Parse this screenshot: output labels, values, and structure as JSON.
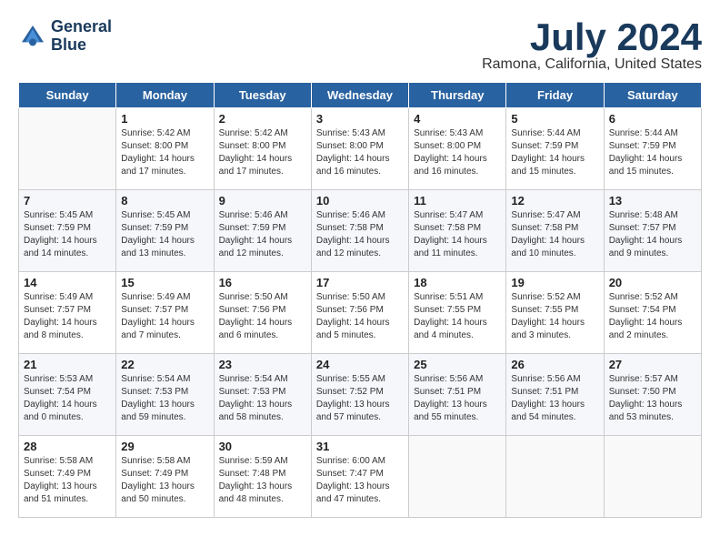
{
  "header": {
    "logo_line1": "General",
    "logo_line2": "Blue",
    "month": "July 2024",
    "location": "Ramona, California, United States"
  },
  "days_of_week": [
    "Sunday",
    "Monday",
    "Tuesday",
    "Wednesday",
    "Thursday",
    "Friday",
    "Saturday"
  ],
  "weeks": [
    [
      {
        "day": "",
        "empty": true
      },
      {
        "day": "1",
        "sunrise": "Sunrise: 5:42 AM",
        "sunset": "Sunset: 8:00 PM",
        "daylight": "Daylight: 14 hours and 17 minutes."
      },
      {
        "day": "2",
        "sunrise": "Sunrise: 5:42 AM",
        "sunset": "Sunset: 8:00 PM",
        "daylight": "Daylight: 14 hours and 17 minutes."
      },
      {
        "day": "3",
        "sunrise": "Sunrise: 5:43 AM",
        "sunset": "Sunset: 8:00 PM",
        "daylight": "Daylight: 14 hours and 16 minutes."
      },
      {
        "day": "4",
        "sunrise": "Sunrise: 5:43 AM",
        "sunset": "Sunset: 8:00 PM",
        "daylight": "Daylight: 14 hours and 16 minutes."
      },
      {
        "day": "5",
        "sunrise": "Sunrise: 5:44 AM",
        "sunset": "Sunset: 7:59 PM",
        "daylight": "Daylight: 14 hours and 15 minutes."
      },
      {
        "day": "6",
        "sunrise": "Sunrise: 5:44 AM",
        "sunset": "Sunset: 7:59 PM",
        "daylight": "Daylight: 14 hours and 15 minutes."
      }
    ],
    [
      {
        "day": "7",
        "sunrise": "Sunrise: 5:45 AM",
        "sunset": "Sunset: 7:59 PM",
        "daylight": "Daylight: 14 hours and 14 minutes."
      },
      {
        "day": "8",
        "sunrise": "Sunrise: 5:45 AM",
        "sunset": "Sunset: 7:59 PM",
        "daylight": "Daylight: 14 hours and 13 minutes."
      },
      {
        "day": "9",
        "sunrise": "Sunrise: 5:46 AM",
        "sunset": "Sunset: 7:59 PM",
        "daylight": "Daylight: 14 hours and 12 minutes."
      },
      {
        "day": "10",
        "sunrise": "Sunrise: 5:46 AM",
        "sunset": "Sunset: 7:58 PM",
        "daylight": "Daylight: 14 hours and 12 minutes."
      },
      {
        "day": "11",
        "sunrise": "Sunrise: 5:47 AM",
        "sunset": "Sunset: 7:58 PM",
        "daylight": "Daylight: 14 hours and 11 minutes."
      },
      {
        "day": "12",
        "sunrise": "Sunrise: 5:47 AM",
        "sunset": "Sunset: 7:58 PM",
        "daylight": "Daylight: 14 hours and 10 minutes."
      },
      {
        "day": "13",
        "sunrise": "Sunrise: 5:48 AM",
        "sunset": "Sunset: 7:57 PM",
        "daylight": "Daylight: 14 hours and 9 minutes."
      }
    ],
    [
      {
        "day": "14",
        "sunrise": "Sunrise: 5:49 AM",
        "sunset": "Sunset: 7:57 PM",
        "daylight": "Daylight: 14 hours and 8 minutes."
      },
      {
        "day": "15",
        "sunrise": "Sunrise: 5:49 AM",
        "sunset": "Sunset: 7:57 PM",
        "daylight": "Daylight: 14 hours and 7 minutes."
      },
      {
        "day": "16",
        "sunrise": "Sunrise: 5:50 AM",
        "sunset": "Sunset: 7:56 PM",
        "daylight": "Daylight: 14 hours and 6 minutes."
      },
      {
        "day": "17",
        "sunrise": "Sunrise: 5:50 AM",
        "sunset": "Sunset: 7:56 PM",
        "daylight": "Daylight: 14 hours and 5 minutes."
      },
      {
        "day": "18",
        "sunrise": "Sunrise: 5:51 AM",
        "sunset": "Sunset: 7:55 PM",
        "daylight": "Daylight: 14 hours and 4 minutes."
      },
      {
        "day": "19",
        "sunrise": "Sunrise: 5:52 AM",
        "sunset": "Sunset: 7:55 PM",
        "daylight": "Daylight: 14 hours and 3 minutes."
      },
      {
        "day": "20",
        "sunrise": "Sunrise: 5:52 AM",
        "sunset": "Sunset: 7:54 PM",
        "daylight": "Daylight: 14 hours and 2 minutes."
      }
    ],
    [
      {
        "day": "21",
        "sunrise": "Sunrise: 5:53 AM",
        "sunset": "Sunset: 7:54 PM",
        "daylight": "Daylight: 14 hours and 0 minutes."
      },
      {
        "day": "22",
        "sunrise": "Sunrise: 5:54 AM",
        "sunset": "Sunset: 7:53 PM",
        "daylight": "Daylight: 13 hours and 59 minutes."
      },
      {
        "day": "23",
        "sunrise": "Sunrise: 5:54 AM",
        "sunset": "Sunset: 7:53 PM",
        "daylight": "Daylight: 13 hours and 58 minutes."
      },
      {
        "day": "24",
        "sunrise": "Sunrise: 5:55 AM",
        "sunset": "Sunset: 7:52 PM",
        "daylight": "Daylight: 13 hours and 57 minutes."
      },
      {
        "day": "25",
        "sunrise": "Sunrise: 5:56 AM",
        "sunset": "Sunset: 7:51 PM",
        "daylight": "Daylight: 13 hours and 55 minutes."
      },
      {
        "day": "26",
        "sunrise": "Sunrise: 5:56 AM",
        "sunset": "Sunset: 7:51 PM",
        "daylight": "Daylight: 13 hours and 54 minutes."
      },
      {
        "day": "27",
        "sunrise": "Sunrise: 5:57 AM",
        "sunset": "Sunset: 7:50 PM",
        "daylight": "Daylight: 13 hours and 53 minutes."
      }
    ],
    [
      {
        "day": "28",
        "sunrise": "Sunrise: 5:58 AM",
        "sunset": "Sunset: 7:49 PM",
        "daylight": "Daylight: 13 hours and 51 minutes."
      },
      {
        "day": "29",
        "sunrise": "Sunrise: 5:58 AM",
        "sunset": "Sunset: 7:49 PM",
        "daylight": "Daylight: 13 hours and 50 minutes."
      },
      {
        "day": "30",
        "sunrise": "Sunrise: 5:59 AM",
        "sunset": "Sunset: 7:48 PM",
        "daylight": "Daylight: 13 hours and 48 minutes."
      },
      {
        "day": "31",
        "sunrise": "Sunrise: 6:00 AM",
        "sunset": "Sunset: 7:47 PM",
        "daylight": "Daylight: 13 hours and 47 minutes."
      },
      {
        "day": "",
        "empty": true
      },
      {
        "day": "",
        "empty": true
      },
      {
        "day": "",
        "empty": true
      }
    ]
  ]
}
